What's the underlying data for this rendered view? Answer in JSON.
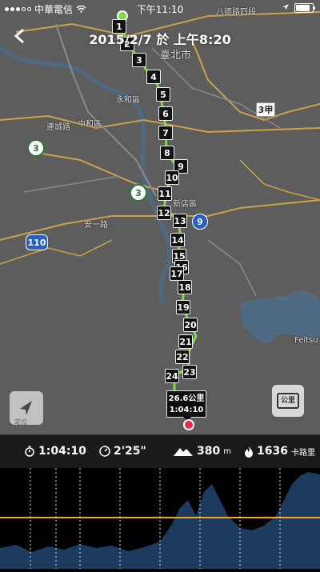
{
  "status_bar": {
    "carrier": "中華電信",
    "time": "下午11:10"
  },
  "header": {
    "title": "2015/2/7 於 上午8:20"
  },
  "map": {
    "labels": [
      {
        "text": "臺北市"
      },
      {
        "text": "永和區"
      },
      {
        "text": "中和區"
      },
      {
        "text": "新店區"
      },
      {
        "text": "安一路"
      },
      {
        "text": "連城路"
      },
      {
        "text": "Feitsu"
      },
      {
        "text": "八德路四段"
      }
    ],
    "shields": [
      {
        "text": "3"
      },
      {
        "text": "3"
      },
      {
        "text": "3甲"
      },
      {
        "text": "9"
      },
      {
        "text": "110"
      }
    ],
    "km_markers": [
      "1",
      "2",
      "3",
      "4",
      "5",
      "6",
      "7",
      "8",
      "9",
      "10",
      "11",
      "12",
      "13",
      "14",
      "15",
      "16",
      "17",
      "18",
      "19",
      "20",
      "21",
      "22",
      "23",
      "24"
    ],
    "tooltip": {
      "distance": "26.6公里",
      "time": "1:04:10"
    },
    "locate_label": "定位",
    "unit_button_label": "公里",
    "route_color": "#7ae041"
  },
  "stats": {
    "duration": "1:04:10",
    "pace": "2'25\"",
    "elevation": "380",
    "elevation_unit": "m",
    "calories": "1636",
    "calories_unit": "卡路里"
  },
  "chart": {
    "line_color": "#f5a623",
    "fill_color": "#1c3b5e"
  }
}
